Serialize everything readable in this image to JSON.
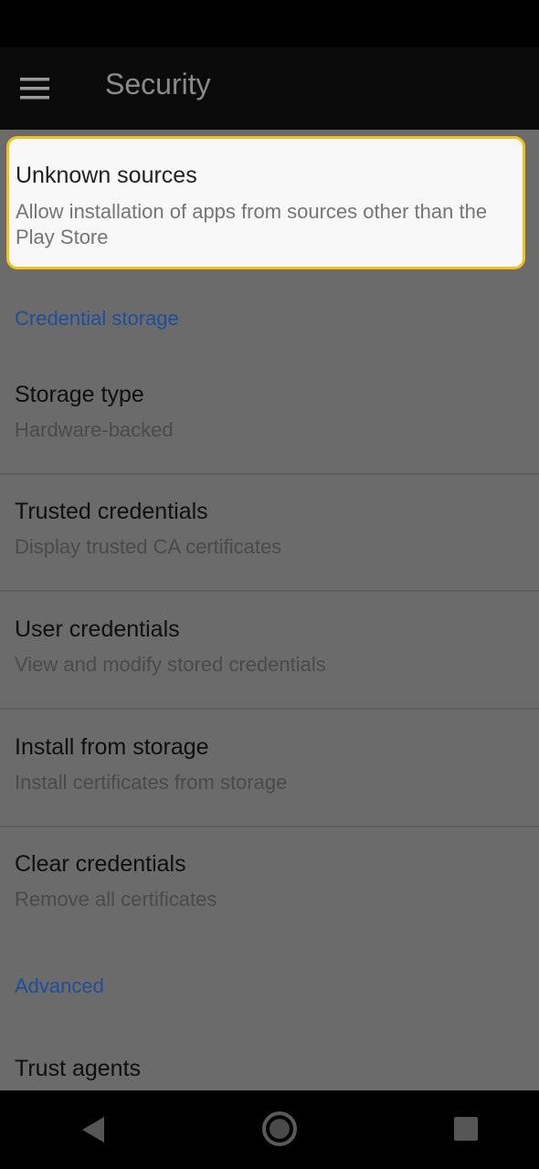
{
  "app_bar": {
    "menu_icon": "hamburger-menu-icon",
    "title": "Security"
  },
  "highlighted_item": {
    "title": "Unknown sources",
    "subtitle": "Allow installation of apps from sources other than the Play Store"
  },
  "sections": {
    "credential_storage": "Credential storage",
    "advanced": "Advanced"
  },
  "credential_items": [
    {
      "title": "Storage type",
      "subtitle": "Hardware-backed"
    },
    {
      "title": "Trusted credentials",
      "subtitle": "Display trusted CA certificates"
    },
    {
      "title": "User credentials",
      "subtitle": "View and modify stored credentials"
    },
    {
      "title": "Install from storage",
      "subtitle": "Install certificates from storage"
    },
    {
      "title": "Clear credentials",
      "subtitle": "Remove all certificates"
    }
  ],
  "advanced_items": [
    {
      "title": "Trust agents"
    }
  ],
  "nav_bar": {
    "back_icon": "back-triangle-icon",
    "home_icon": "home-circle-icon",
    "recents_icon": "recents-square-icon"
  },
  "colors": {
    "highlight_border": "#f2c21b",
    "section_header": "#1d4f9a",
    "scrim": "#6b6b6b"
  }
}
